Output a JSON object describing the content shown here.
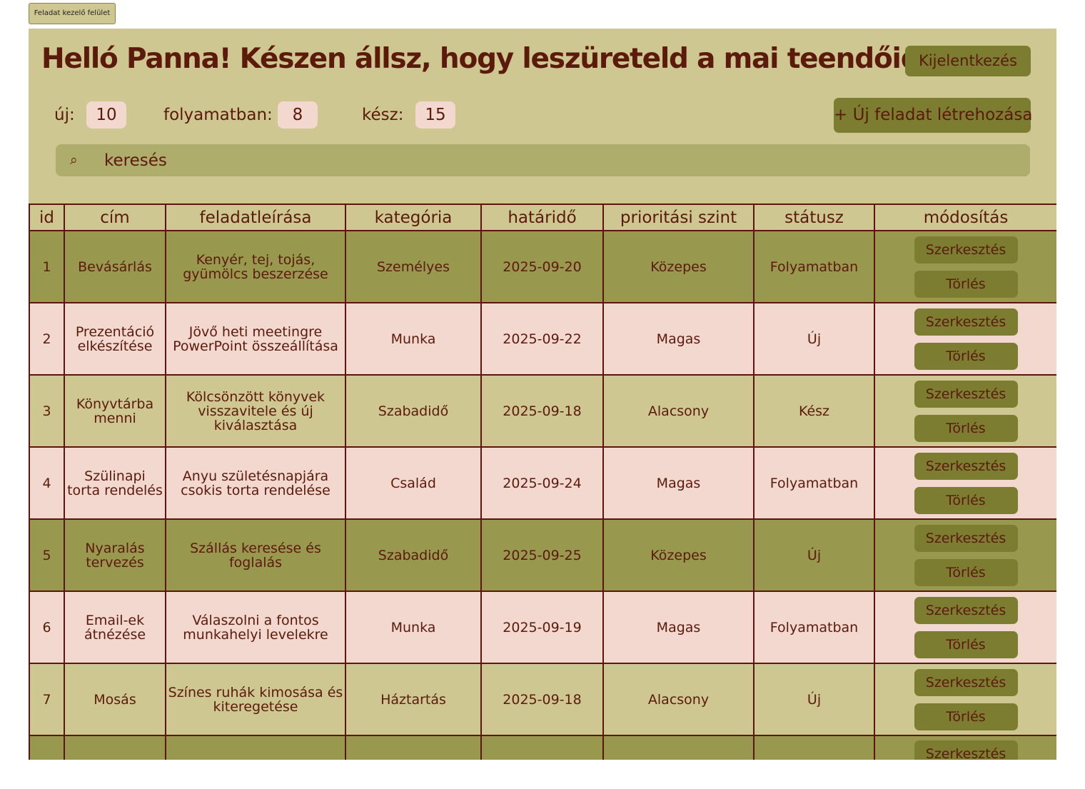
{
  "tab": {
    "label": "Feladat kezelő felület"
  },
  "header": {
    "greeting": "Helló Panna! Készen állsz, hogy leszüreteld a mai teendőidet?",
    "logout_label": "Kijelentkezés",
    "new_task_label": "+ Új feladat létrehozása"
  },
  "counters": {
    "new_label": "új:",
    "new_value": "10",
    "in_progress_label": "folyamatban:",
    "in_progress_value": "8",
    "done_label": "kész:",
    "done_value": "15"
  },
  "search": {
    "icon": "search-icon",
    "placeholder": "keresés",
    "value": ""
  },
  "table": {
    "headers": [
      "id",
      "cím",
      "feladatleírása",
      "kategória",
      "határidő",
      "prioritási szint",
      "státusz",
      "módosítás"
    ],
    "edit_label": "Szerkesztés",
    "delete_label": "Törlés",
    "rows": [
      {
        "id": "1",
        "title": "Bevásárlás",
        "description": "Kenyér, tej, tojás, gyümölcs beszerzése",
        "category": "Személyes",
        "deadline": "2025-09-20",
        "priority": "Közepes",
        "status": "Folyamatban"
      },
      {
        "id": "2",
        "title": "Prezentáció elkészítése",
        "description": "Jövő heti meetingre PowerPoint összeállítása",
        "category": "Munka",
        "deadline": "2025-09-22",
        "priority": "Magas",
        "status": "Új"
      },
      {
        "id": "3",
        "title": "Könyvtárba menni",
        "description": "Kölcsönzött könyvek visszavitele és új kiválasztása",
        "category": "Szabadidő",
        "deadline": "2025-09-18",
        "priority": "Alacsony",
        "status": "Kész"
      },
      {
        "id": "4",
        "title": "Szülinapi torta rendelés",
        "description": "Anyu születésnapjára csokis torta rendelése",
        "category": "Család",
        "deadline": "2025-09-24",
        "priority": "Magas",
        "status": "Folyamatban"
      },
      {
        "id": "5",
        "title": "Nyaralás tervezés",
        "description": "Szállás keresése és foglalás",
        "category": "Szabadidő",
        "deadline": "2025-09-25",
        "priority": "Közepes",
        "status": "Új"
      },
      {
        "id": "6",
        "title": "Email-ek átnézése",
        "description": "Válaszolni a fontos munkahelyi levelekre",
        "category": "Munka",
        "deadline": "2025-09-19",
        "priority": "Magas",
        "status": "Folyamatban"
      },
      {
        "id": "7",
        "title": "Mosás",
        "description": "Színes ruhák kimosása és kiteregetése",
        "category": "Háztartás",
        "deadline": "2025-09-18",
        "priority": "Alacsony",
        "status": "Új"
      }
    ]
  },
  "colors": {
    "panel": "#cfc792",
    "row_dark": "#99984f",
    "row_pink": "#f3d8cf",
    "button": "#7c7d30",
    "search": "#aead6c",
    "text": "#5b1a0c",
    "border": "#5e1410"
  }
}
